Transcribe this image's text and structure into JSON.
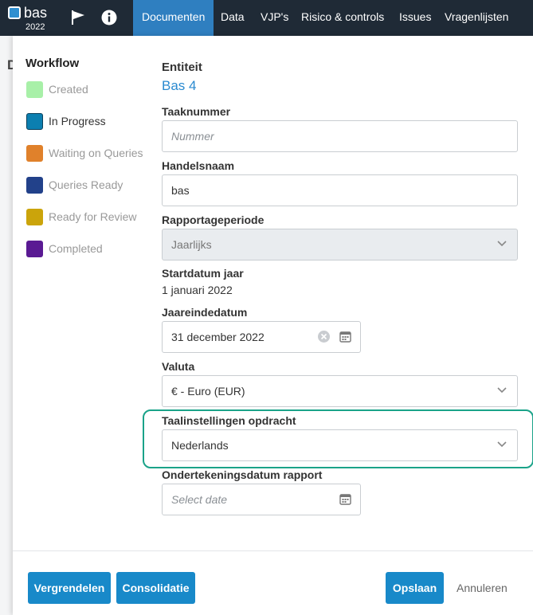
{
  "brand": {
    "name": "bas",
    "year": "2022"
  },
  "nav": {
    "items": [
      {
        "label": "Documenten",
        "active": true
      },
      {
        "label": "Data"
      },
      {
        "label": "VJP's"
      },
      {
        "label": "Risico & controls"
      },
      {
        "label": "Issues"
      },
      {
        "label": "Vragenlijsten"
      }
    ],
    "icons": [
      "flag-icon",
      "info-icon"
    ]
  },
  "background": {
    "partial_heading": "D"
  },
  "workflow": {
    "title": "Workflow",
    "steps": [
      {
        "label": "Created",
        "color": "#a8f0a8"
      },
      {
        "label": "In Progress",
        "color": "#0c7fb0",
        "current": true
      },
      {
        "label": "Waiting on Queries",
        "color": "#e0812b"
      },
      {
        "label": "Queries Ready",
        "color": "#22418a"
      },
      {
        "label": "Ready for Review",
        "color": "#cba40b"
      },
      {
        "label": "Completed",
        "color": "#5a1a93"
      }
    ]
  },
  "form": {
    "entity_label": "Entiteit",
    "entity_value": "Bas 4",
    "task_number_label": "Taaknummer",
    "task_number_placeholder": "Nummer",
    "trade_name_label": "Handelsnaam",
    "trade_name_value": "bas",
    "period_label": "Rapportageperiode",
    "period_value": "Jaarlijks",
    "start_label": "Startdatum jaar",
    "start_value": "1 januari 2022",
    "year_end_label": "Jaareindedatum",
    "year_end_value": "31 december 2022",
    "currency_label": "Valuta",
    "currency_value": "€ - Euro (EUR)",
    "language_label": "Taalinstellingen opdracht",
    "language_value": "Nederlands",
    "signing_label": "Ondertekeningsdatum rapport",
    "signing_placeholder": "Select date"
  },
  "buttons": {
    "lock": "Vergrendelen",
    "consolidate": "Consolidatie",
    "save": "Opslaan",
    "cancel": "Annuleren"
  },
  "colors": {
    "accent": "#1889c9",
    "nav_bg": "#1f2a36",
    "highlight": "#1aa389"
  }
}
